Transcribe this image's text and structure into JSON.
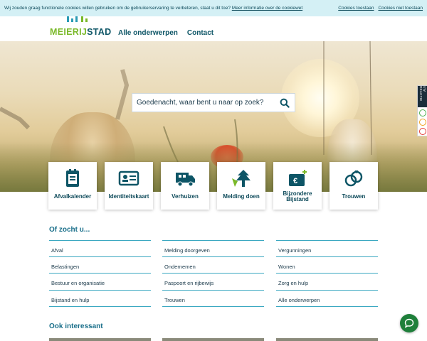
{
  "cookie_bar": {
    "message": "Wij zouden graag functionele cookies willen gebruiken om de gebruikerservaring te verbeteren, staat u dit toe?",
    "more_info_link": "Meer informatie over de cookiewet",
    "accept_label": "Cookies toestaan",
    "reject_label": "Cookies niet toestaan"
  },
  "header": {
    "logo_part1": "MEIERIJ",
    "logo_part2": "STAD",
    "nav": [
      "Alle onderwerpen",
      "Contact"
    ]
  },
  "search": {
    "placeholder": "Goedenacht, waar bent u naar op zoek?"
  },
  "feedback_tab": {
    "label": "UW REACTIE"
  },
  "tiles": [
    {
      "label": "Afvalkalender",
      "icon": "calendar-icon"
    },
    {
      "label": "Identiteitskaart",
      "icon": "id-card-icon"
    },
    {
      "label": "Verhuizen",
      "icon": "moving-truck-icon"
    },
    {
      "label": "Melding doen",
      "icon": "report-tree-icon"
    },
    {
      "label": "Bijzondere Bijstand",
      "icon": "euro-wallet-icon"
    },
    {
      "label": "Trouwen",
      "icon": "wedding-rings-icon"
    }
  ],
  "of_zocht_u": {
    "title": "Of zocht u...",
    "columns": [
      [
        "Afval",
        "Belastingen",
        "Bestuur en organisatie",
        "Bijstand en hulp"
      ],
      [
        "Melding doorgeven",
        "Ondernemen",
        "Paspoort en rijbewijs",
        "Trouwen"
      ],
      [
        "Vergunningen",
        "Wonen",
        "Zorg en hulp",
        "Alle onderwerpen"
      ]
    ]
  },
  "ook_interessant": {
    "title": "Ook interessant"
  },
  "colors": {
    "brand_green": "#7ab929",
    "brand_teal": "#0d5566",
    "link_line": "#3aa8c1",
    "cookie_bg": "#d4f0f5",
    "chat_green": "#1e7f3a"
  },
  "chat_button": {
    "icon": "chat-bubble-icon"
  }
}
